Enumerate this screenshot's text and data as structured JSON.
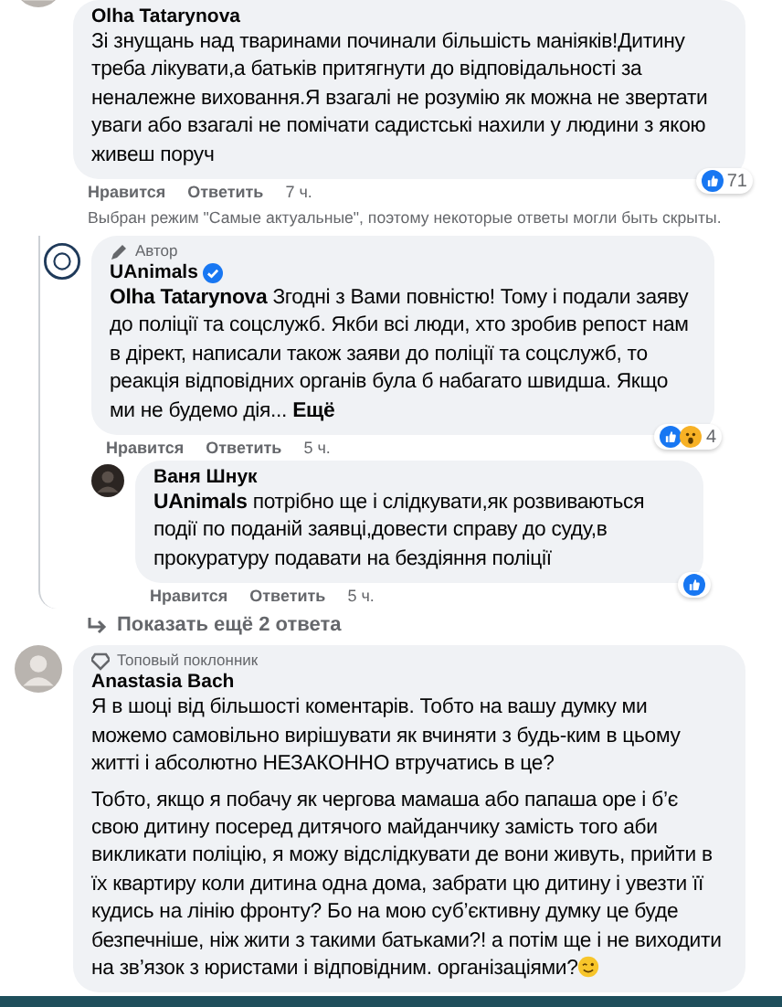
{
  "comments": [
    {
      "author": "Olha Tatarynova",
      "avatar": {
        "kind": "person"
      },
      "paragraphs": [
        {
          "kind": "plain",
          "text": "Зі знущань над тваринами починали більшість маніяків!Дитину треба лікувати,а батьків притягнути до відповідальності за неналежне виховання.Я взагалі не розумію як можна не звертати уваги або взагалі не помічати садистські нахили у людини з якою живеш поруч"
        }
      ],
      "reactions": {
        "items": [
          {
            "kind": "like"
          }
        ],
        "count": "71"
      },
      "actions": [
        "Нравится",
        "Ответить"
      ],
      "time": "7 ч.",
      "notice": "Выбран режим \"Самые актуальные\", поэтому некоторые ответы могли быть скрыты.",
      "replies": [
        {
          "author": "UAnimals",
          "avatar": {
            "kind": "logo"
          },
          "badge": {
            "kind": "author",
            "label": "Автор"
          },
          "verified": true,
          "mention": "Olha Tatarynova",
          "paragraphs": [
            {
              "text": "Згодні з Вами повністю! Тому і подали заяву до поліції та соцслужб. Якби всі люди, хто зробив репост нам в дірект, написали також заяви до поліції та соцслужб, то реакція відповідних органів була б набагато швидша. Якщо ми не будемо дія..."
            }
          ],
          "more": "Ещё",
          "reactions": {
            "items": [
              {
                "kind": "like"
              },
              {
                "kind": "wow"
              }
            ],
            "count": "4"
          },
          "actions": [
            "Нравится",
            "Ответить"
          ],
          "time": "5 ч.",
          "replies": [
            {
              "author": "Ваня Шнук",
              "avatar": {
                "kind": "person"
              },
              "mention": "UAnimals",
              "paragraphs": [
                {
                  "text": "потрібно ще і слідкувати,як розвиваються події по поданій заявці,довести справу до суду,в прокуратуру подавати на бездіяння поліції"
                }
              ],
              "reactions": {
                "items": [
                  {
                    "kind": "like"
                  }
                ]
              },
              "actions": [
                "Нравится",
                "Ответить"
              ],
              "time": "5 ч."
            }
          ]
        }
      ],
      "more_replies": "Показать ещё 2 ответа"
    },
    {
      "author": "Anastasia Bach",
      "avatar": {
        "kind": "person"
      },
      "badge": {
        "kind": "fan",
        "label": "Топовый поклонник"
      },
      "paragraphs": [
        {
          "kind": "plain",
          "text": "Я в шоці від більшості коментарів. Тобто на вашу думку ми можемо самовільно вирішувати як вчиняти з будь-ким в цьому житті і абсолютно НЕЗАКОННО втручатись в це?"
        },
        {
          "kind": "wink",
          "text": "Тобто, якщо я побачу як чергова мамаша або папаша оре і б’є свою дитину посеред дитячого майданчику замість того аби викликати поліцію, я можу відслідкувати де вони живуть, прийти в їх квартиру коли дитина одна дома, забрати цю дитину і увезти її кудись на лінію фронту? Бо на мою суб’єктивну думку це буде безпечніше, ніж жити з такими батьками?! а потім ще і не виходити на зв’язок з юристами і відповідним. організаціями?"
        }
      ]
    }
  ]
}
